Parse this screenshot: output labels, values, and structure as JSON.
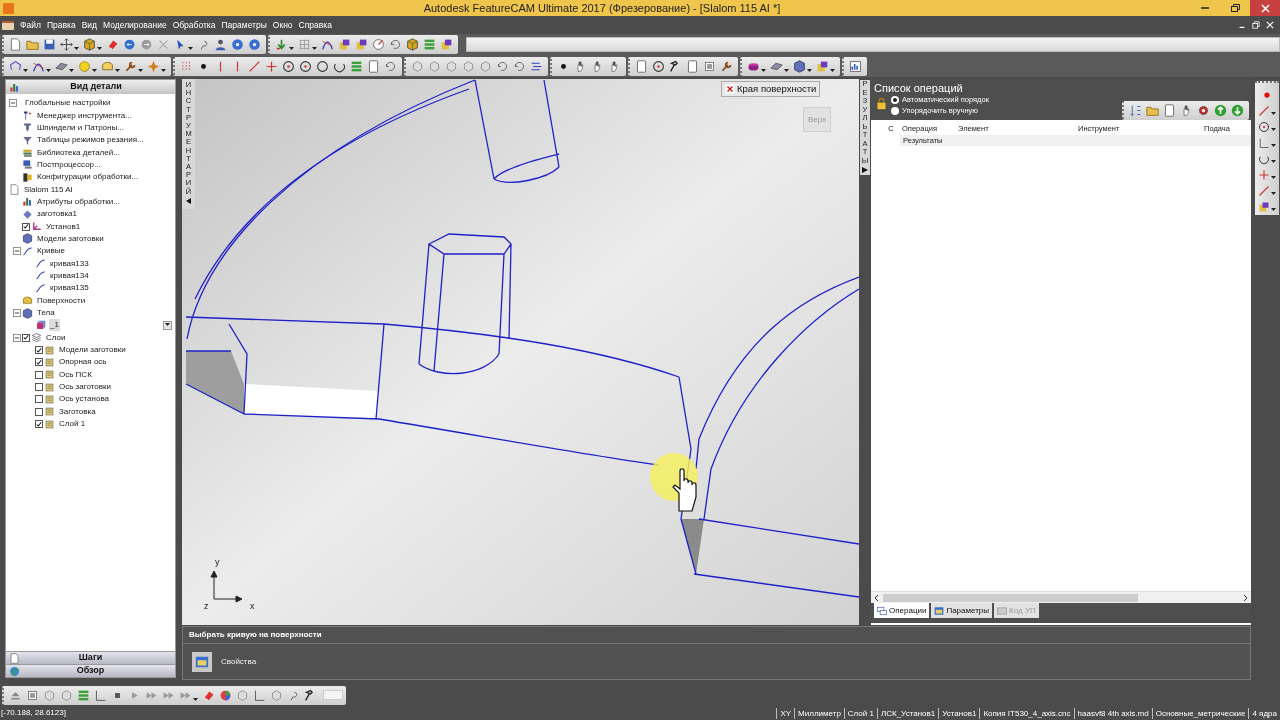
{
  "window": {
    "title": "Autodesk FeatureCAM Ultimate 2017 (Фрезерование) - [Slalom 115 AI *]"
  },
  "menu": [
    "Файл",
    "Правка",
    "Вид",
    "Моделирование",
    "Обработка",
    "Параметры",
    "Окно",
    "Справка"
  ],
  "part_view": {
    "title": "Вид детали",
    "tree": [
      {
        "label": "Глобальные настройки",
        "selected": false,
        "expanded": true,
        "children": [
          {
            "label": "Менеджер инструмента...",
            "kind": "tool",
            "selected": false
          },
          {
            "label": "Шпиндели и Патроны...",
            "kind": "spindle",
            "selected": false
          },
          {
            "label": "Таблицы режимов резания...",
            "kind": "funnel",
            "selected": false
          },
          {
            "label": "Библиотека деталей...",
            "kind": "books",
            "selected": false
          },
          {
            "label": "Постпроцессор...",
            "kind": "computer",
            "selected": false
          },
          {
            "label": "Конфигурации обработки...",
            "kind": "machine",
            "selected": false
          }
        ]
      },
      {
        "label": "Slalom 115 AI",
        "kind": "document",
        "selected": false,
        "children": [
          {
            "label": "Атрибуты обработки...",
            "kind": "barchart",
            "selected": false
          },
          {
            "label": "заготовка1",
            "kind": "diamond",
            "selected": false
          },
          {
            "label": "Установ1",
            "kind": "axes",
            "selected": false,
            "checked": true
          },
          {
            "label": "Модели заготовки",
            "kind": "cubeblue",
            "selected": false
          },
          {
            "label": "Кривые",
            "kind": "curve",
            "selected": false,
            "expanded": true,
            "children": [
              {
                "label": "кривая133",
                "kind": "curve",
                "selected": false
              },
              {
                "label": "кривая134",
                "kind": "curve",
                "selected": false
              },
              {
                "label": "кривая135",
                "kind": "curve",
                "selected": false
              }
            ]
          },
          {
            "label": "Поверхности",
            "kind": "surface",
            "selected": false
          },
          {
            "label": "Тела",
            "kind": "cubeblue",
            "selected": false,
            "expanded": true,
            "children": [
              {
                "label": "_1",
                "kind": "solid",
                "selected": true
              }
            ]
          },
          {
            "label": "Слои",
            "kind": "layers",
            "selected": false,
            "checked": true,
            "expanded": true,
            "children": [
              {
                "label": "Модели заготовки",
                "kind": "layer",
                "selected": false,
                "checked": true
              },
              {
                "label": "Опорная ось",
                "kind": "layer",
                "selected": false,
                "checked": true
              },
              {
                "label": "Ось ПСК",
                "kind": "layer",
                "selected": false,
                "checked": false
              },
              {
                "label": "Ось заготовки",
                "kind": "layer",
                "selected": false,
                "checked": false
              },
              {
                "label": "Ось установа",
                "kind": "layer",
                "selected": false,
                "checked": false
              },
              {
                "label": "Заготовка",
                "kind": "layer",
                "selected": false,
                "checked": false
              },
              {
                "label": "Слой 1",
                "kind": "layer",
                "selected": false,
                "checked": true
              }
            ]
          }
        ]
      }
    ],
    "buttons": [
      "Шаги",
      "Обзор"
    ]
  },
  "side_tabs": {
    "left": "ИНСТРУМЕНТАРИЙ",
    "right": "РЕЗУЛЬТАТЫ"
  },
  "viewport": {
    "tooltip": "Края поверхности",
    "view_cube": "Верх",
    "axes": [
      {
        "label": "y"
      },
      {
        "label": "z"
      },
      {
        "label": "x"
      }
    ]
  },
  "operations": {
    "title": "Список операций",
    "order": [
      {
        "label": "Автоматический порядок",
        "selected": true
      },
      {
        "label": "Упорядочить вручную",
        "selected": false
      }
    ],
    "columns": [
      "С",
      "Операция",
      "Элемент",
      "Инструмент",
      "Подача"
    ],
    "rows": [
      {
        "label": "Результаты"
      }
    ],
    "tabs": [
      {
        "label": "Операции",
        "selected": true,
        "disabled": false
      },
      {
        "label": "Параметры",
        "selected": false,
        "disabled": false
      },
      {
        "label": "Код УП",
        "selected": false,
        "disabled": true
      }
    ]
  },
  "prompt": {
    "title": "Выбрать кривую на поверхности",
    "button": "Свойства"
  },
  "status_bar": {
    "coordinates": "[-70.188, 28.6123]",
    "fields": [
      "XY",
      "Миллиметр",
      "Слой 1",
      "ЛСК_Установ1",
      "Установ1",
      "Копия IT530_4_axis.cnc",
      "haasvf8 4th axis.md",
      "Основные_метрические",
      "4 ядра"
    ]
  }
}
